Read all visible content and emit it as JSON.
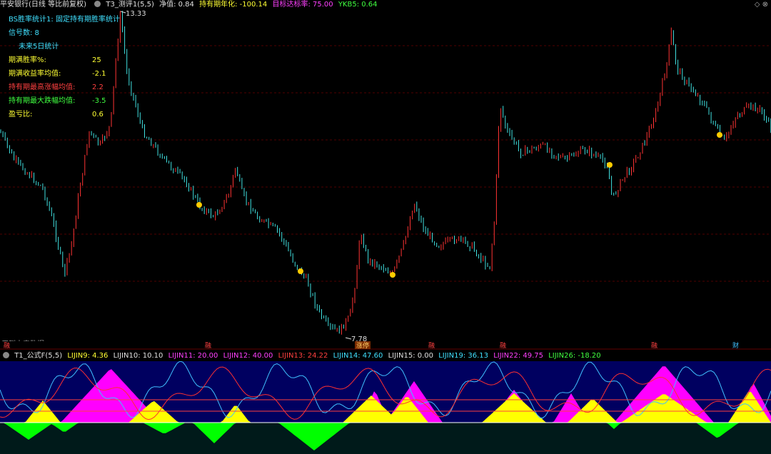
{
  "header": {
    "stock_title": "平安银行(日线 等比前复权)",
    "indicator_name": "T3_测评1(5,5)",
    "items": [
      {
        "label": "净值: 0.84",
        "color": "#e0e0e0"
      },
      {
        "label": "持有期年化: -100.14",
        "color": "#ffff33"
      },
      {
        "label": "目标达标率: 75.00",
        "color": "#ff40ff"
      },
      {
        "label": "YKB5: 0.64",
        "color": "#40ff40"
      }
    ]
  },
  "stats": {
    "title": "BS胜率统计1: 固定持有期胜率统计",
    "signal_count": "信号数: 8",
    "future_label": "未来5日统计",
    "rows": [
      {
        "label": "期满胜率%:",
        "value": "25",
        "color": "#ffff33"
      },
      {
        "label": "期满收益率均值:",
        "value": "-2.1",
        "color": "#ffff33"
      },
      {
        "label": "持有期最高涨幅均值:",
        "value": "2.2",
        "color": "#ff4040"
      },
      {
        "label": "持有期最大跌幅均值:",
        "value": "-3.5",
        "color": "#40ff40"
      },
      {
        "label": "盈亏比:",
        "value": "0.6",
        "color": "#ffff33"
      }
    ]
  },
  "main_chart": {
    "high_label": "13.33",
    "low_label": "7.78",
    "no_future_label": "用到未来数据",
    "marker_rong": "融",
    "marker_zhangting": "涨停",
    "marker_cai": "财"
  },
  "sub_header": {
    "name": "T1_公式F(5,5)",
    "items": [
      {
        "label": "LIJIN9: 4.36",
        "color": "#ffff33"
      },
      {
        "label": "LIJIN10: 10.10",
        "color": "#e0e0e0"
      },
      {
        "label": "LIJIN11: 20.00",
        "color": "#ff40ff"
      },
      {
        "label": "LIJIN12: 40.00",
        "color": "#ff40ff"
      },
      {
        "label": "LIJIN13: 24.22",
        "color": "#ff4040"
      },
      {
        "label": "LIJIN14: 47.60",
        "color": "#40e0ff"
      },
      {
        "label": "LIJIN15: 0.00",
        "color": "#e0e0e0"
      },
      {
        "label": "LIJIN19: 36.13",
        "color": "#40e0ff"
      },
      {
        "label": "LIJIN22: 49.75",
        "color": "#ff40ff"
      },
      {
        "label": "LIJIN26: -18.20",
        "color": "#40ff40"
      }
    ]
  },
  "colors": {
    "up": "#ff3333",
    "down": "#40e0e0",
    "signal_dot": "#ffcc00",
    "grid": "#500000",
    "magenta": "#ff00ff",
    "yellow": "#ffff00",
    "green": "#00ff00",
    "sub_bg": "#000060"
  }
}
